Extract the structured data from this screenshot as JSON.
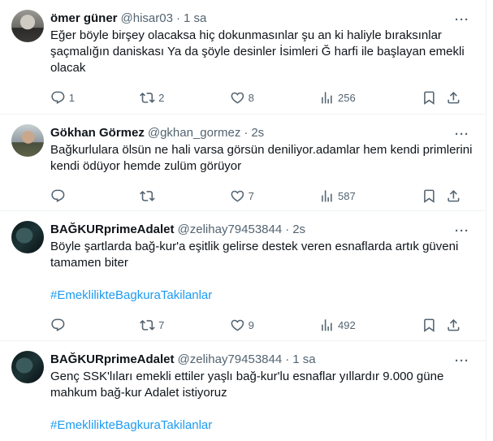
{
  "tweets": [
    {
      "name": "ömer güner",
      "handle": "@hisar03",
      "time": "1 sa",
      "text": "Eğer böyle birşey olacaksa hiç dokunmasınlar şu an ki haliyle bıraksınlar şaçmalığın daniskası Ya da şöyle desinler İsimleri Ğ harfi ile başlayan emekli olacak",
      "hashtag": "",
      "replies": "1",
      "retweets": "2",
      "likes": "8",
      "views": "256"
    },
    {
      "name": "Gökhan Görmez",
      "handle": "@gkhan_gormez",
      "time": "2s",
      "text": "Bağkurlulara ölsün ne hali varsa görsün deniliyor.adamlar hem kendi primlerini kendi ödüyor hemde zulüm görüyor",
      "hashtag": "",
      "replies": "",
      "retweets": "",
      "likes": "7",
      "views": "587"
    },
    {
      "name": "BAĞKURprimeAdalet",
      "handle": "@zelihay79453844",
      "time": "2s",
      "text": "Böyle şartlarda bağ-kur'a eşitlik gelirse destek veren esnaflarda artık güveni tamamen biter",
      "hashtag": "#EmeklilikteBagkuraTakilanlar",
      "replies": "",
      "retweets": "7",
      "likes": "9",
      "views": "492"
    },
    {
      "name": "BAĞKURprimeAdalet",
      "handle": "@zelihay79453844",
      "time": "1 sa",
      "text": "Genç SSK'lıları emekli ettiler yaşlı bağ-kur'lu esnaflar yıllardır 9.000 güne mahkum bağ-kur Adalet istiyoruz",
      "hashtag": "#EmeklilikteBagkuraTakilanlar"
    }
  ],
  "ui": {
    "dot": "·",
    "more": "···"
  },
  "icons": {
    "reply": "reply-icon",
    "retweet": "retweet-icon",
    "like": "heart-icon",
    "views": "views-chart-icon",
    "bookmark": "bookmark-icon",
    "share": "share-icon",
    "more": "more-icon"
  },
  "colors": {
    "text": "#0f1419",
    "secondary": "#536471",
    "link": "#1d9bf0",
    "divider": "#eff3f4"
  }
}
